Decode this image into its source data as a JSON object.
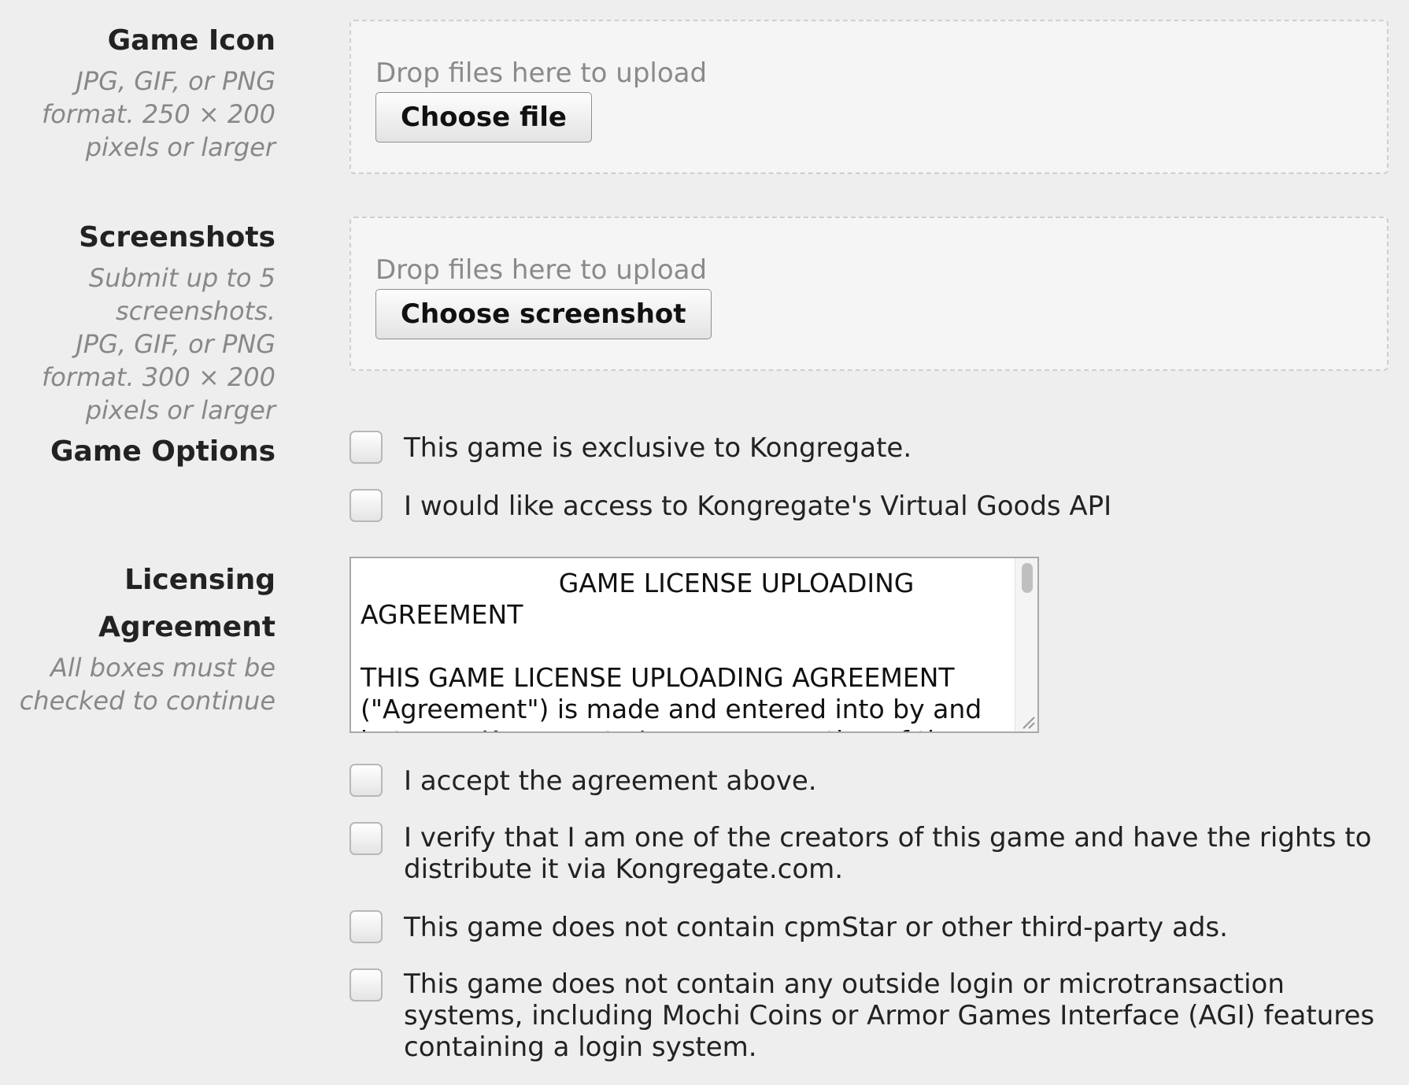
{
  "game_icon": {
    "title": "Game Icon",
    "hint_lines": [
      "JPG, GIF, or PNG",
      "format. 250 × 200",
      "pixels or larger"
    ],
    "drop_text": "Drop files here to upload",
    "button_label": "Choose file"
  },
  "screenshots": {
    "title": "Screenshots",
    "hint_lines": [
      "Submit up to 5",
      "screenshots.",
      "JPG, GIF, or PNG",
      "format. 300 × 200",
      "pixels or larger"
    ],
    "drop_text": "Drop files here to upload",
    "button_label": "Choose screenshot"
  },
  "game_options": {
    "title": "Game Options",
    "options": [
      {
        "label": "This game is exclusive to Kongregate.",
        "checked": false
      },
      {
        "label": "I would like access to Kongregate's Virtual Goods API",
        "checked": false
      }
    ]
  },
  "licensing": {
    "title_lines": [
      "Licensing",
      "Agreement"
    ],
    "hint_lines": [
      "All boxes must be",
      "checked to continue"
    ],
    "agreement_text": "                        GAME LICENSE UPLOADING AGREEMENT\n\nTHIS GAME LICENSE UPLOADING AGREEMENT (\"Agreement\") is made and entered into by and between Kongregate Inc., a corporation of the",
    "confirmations": [
      {
        "label": "I accept the agreement above.",
        "checked": false
      },
      {
        "label": "I verify that I am one of the creators of this game and have the rights to distribute it via Kongregate.com.",
        "checked": false
      },
      {
        "label": "This game does not contain cpmStar or other third-party ads.",
        "checked": false
      },
      {
        "label": "This game does not contain any outside login or microtransaction systems, including Mochi Coins or Armor Games Interface (AGI) features containing a login system.",
        "checked": false
      }
    ]
  }
}
